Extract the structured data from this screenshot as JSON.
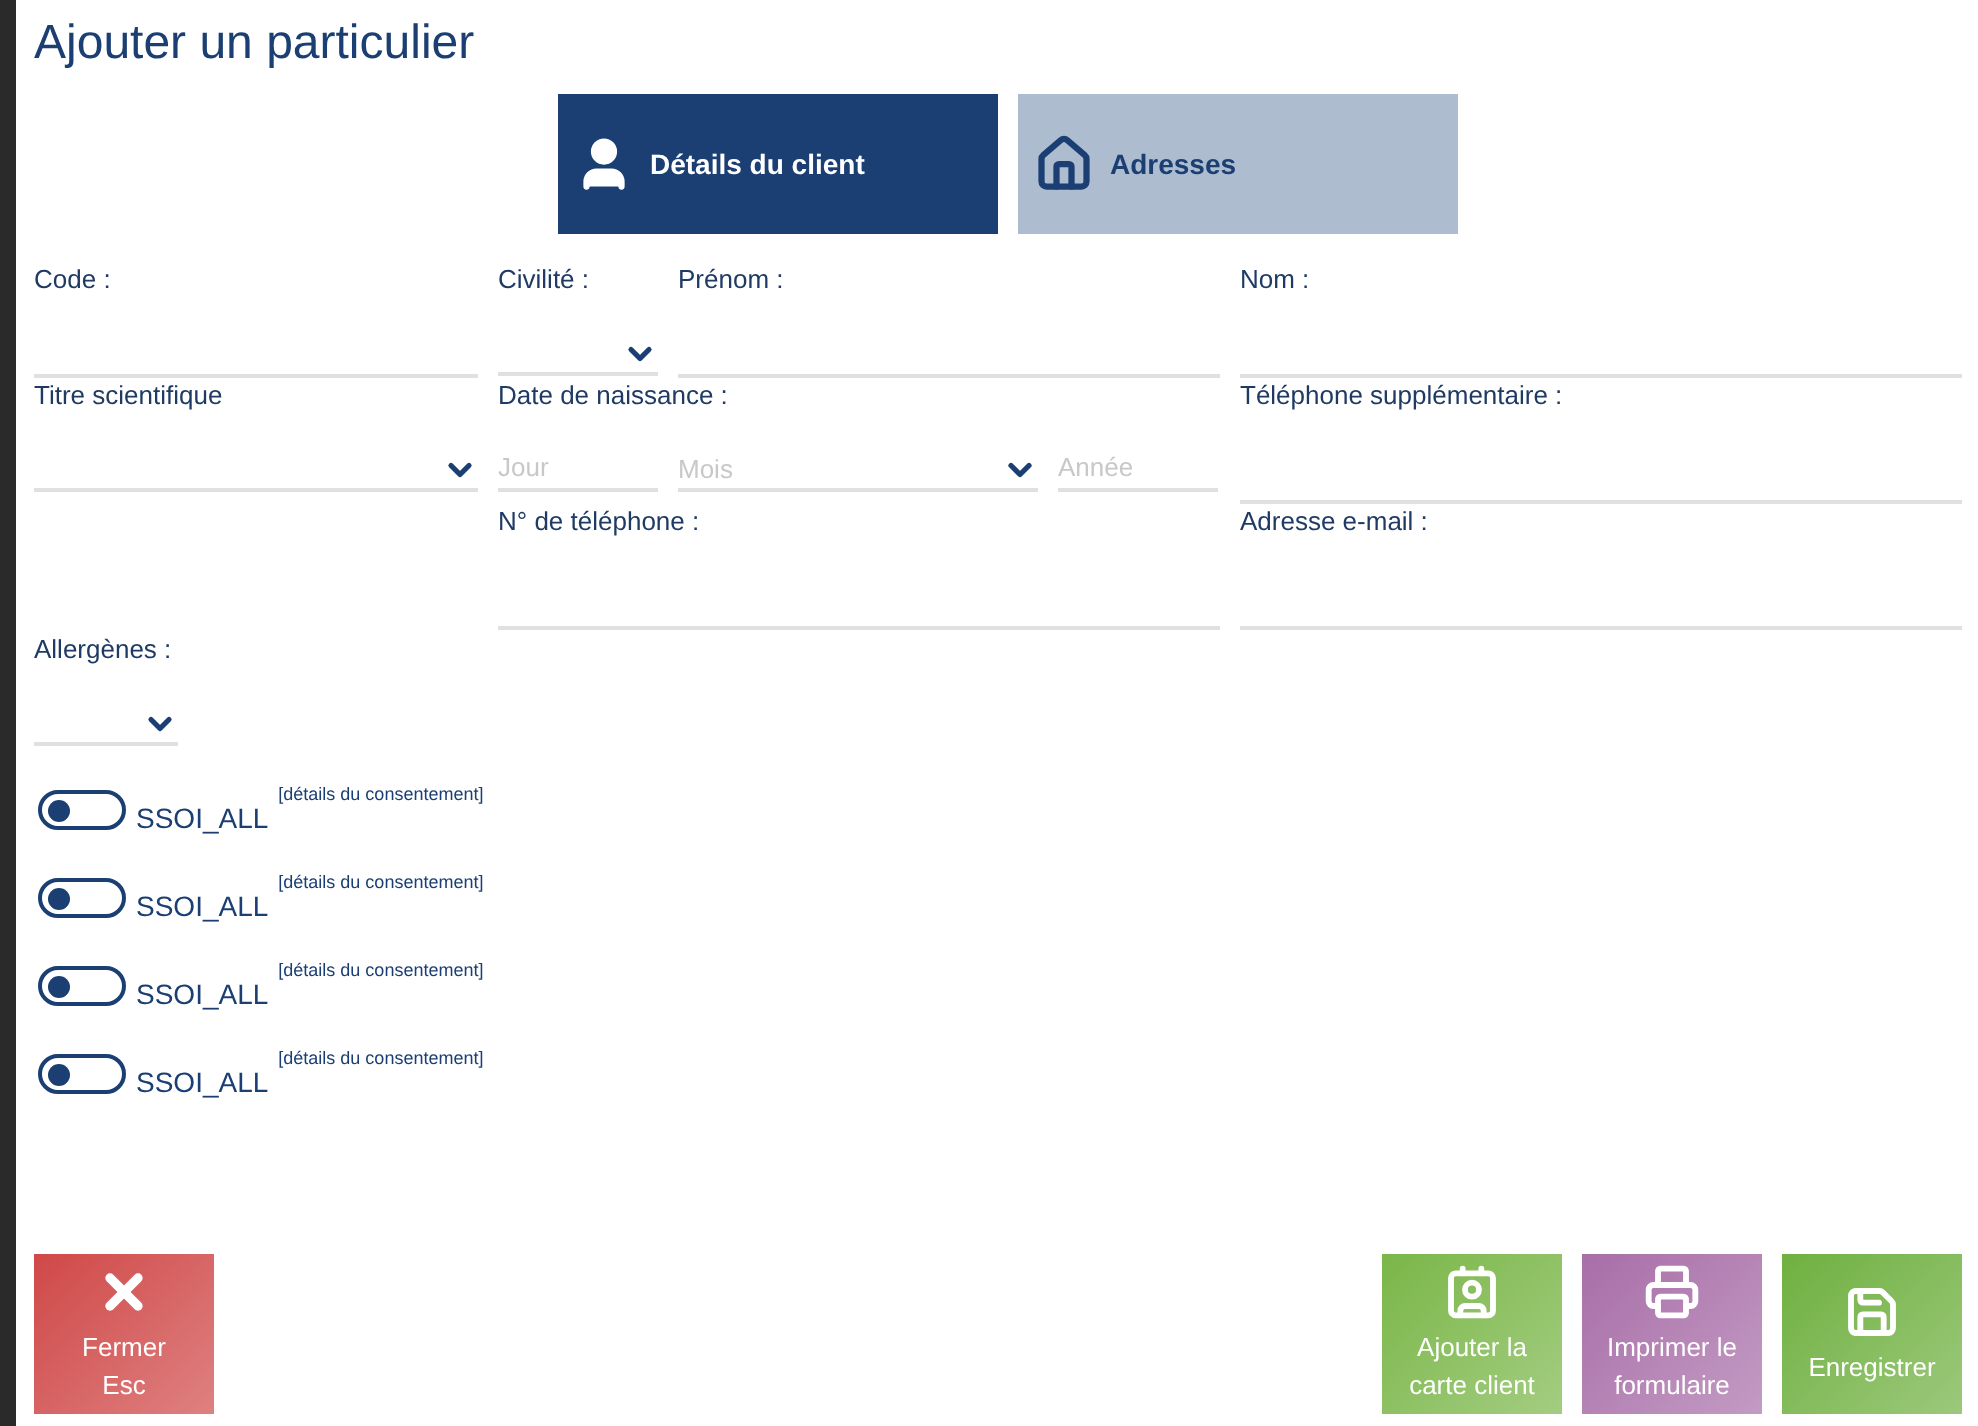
{
  "title": "Ajouter un particulier",
  "tabs": [
    {
      "label": "Détails du client",
      "selected": true,
      "kind": "person"
    },
    {
      "label": "Adresses",
      "selected": false,
      "kind": "home"
    }
  ],
  "fields": [
    {
      "label": "Code :",
      "kind": "text"
    },
    {
      "label": "Civilité :",
      "kind": "select"
    },
    {
      "label": "Prénom :",
      "kind": "text"
    },
    {
      "label": "Nom :",
      "kind": "text"
    },
    {
      "label": "Titre scientifique",
      "kind": "select"
    },
    {
      "label": "Date de naissance :",
      "kind": "date",
      "parts": [
        {
          "placeholder": "Jour",
          "kind": "text"
        },
        {
          "placeholder": "Mois",
          "kind": "select"
        },
        {
          "placeholder": "Année",
          "kind": "text"
        }
      ]
    },
    {
      "label": "Téléphone supplémentaire :",
      "kind": "text"
    },
    {
      "label": "N° de téléphone :",
      "kind": "text"
    },
    {
      "label": "Adresse e-mail :",
      "kind": "text"
    },
    {
      "label": "Allergènes :",
      "kind": "select"
    }
  ],
  "consents": [
    {
      "label": "SSOI_ALL",
      "link": "[détails du consentement]",
      "on": false
    },
    {
      "label": "SSOI_ALL",
      "link": "[détails du consentement]",
      "on": false
    },
    {
      "label": "SSOI_ALL",
      "link": "[détails du consentement]",
      "on": false
    },
    {
      "label": "SSOI_ALL",
      "link": "[détails du consentement]",
      "on": false
    }
  ],
  "buttons": [
    {
      "lines": [
        "Fermer",
        "Esc"
      ],
      "kind": "close",
      "color": "#d04848"
    },
    {
      "lines": [
        "Ajouter la",
        "carte client"
      ],
      "kind": "card",
      "color": "#7ab648"
    },
    {
      "lines": [
        "Imprimer le",
        "formulaire"
      ],
      "kind": "printer",
      "color": "#a86ea8"
    },
    {
      "lines": [
        "Enregistrer"
      ],
      "kind": "save",
      "color": "#6fb040"
    }
  ]
}
